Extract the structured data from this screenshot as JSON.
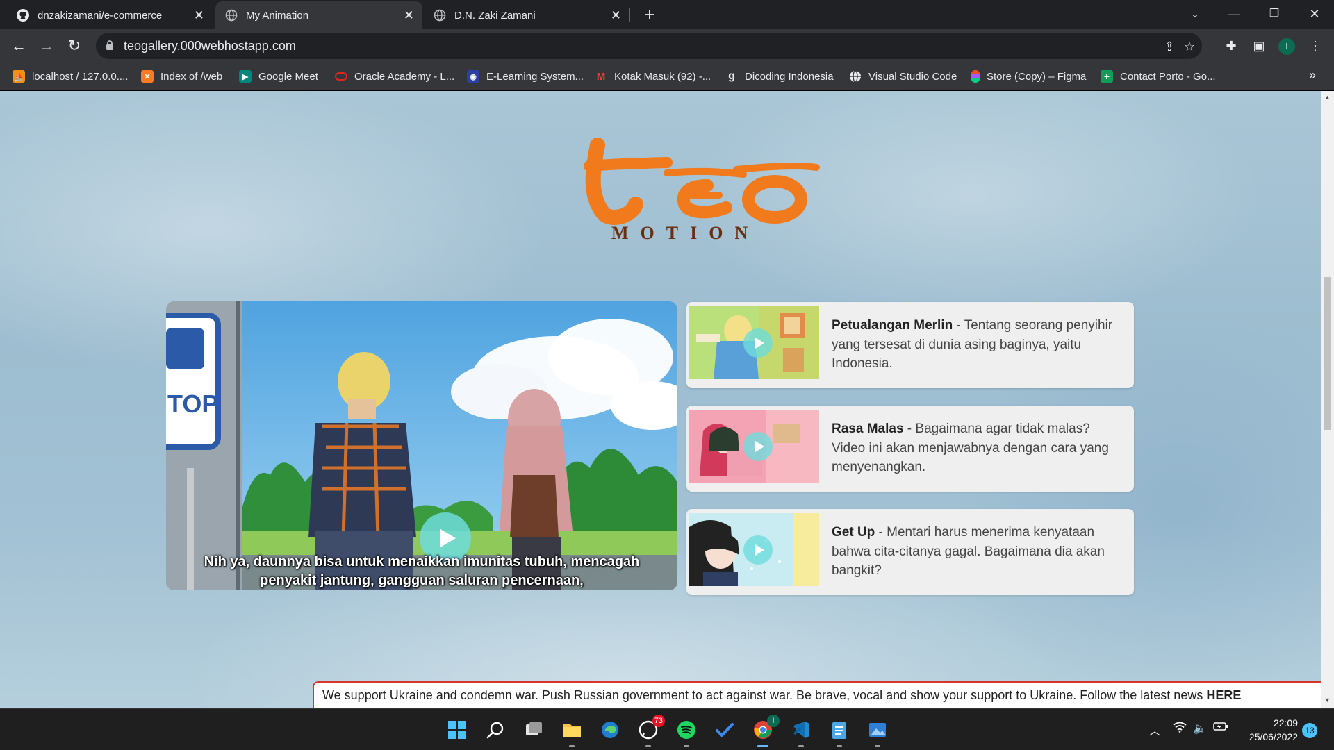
{
  "browser": {
    "tabs": [
      {
        "title": "dnzakizamani/e-commerce",
        "icon": "github-icon"
      },
      {
        "title": "My Animation",
        "icon": "globe-icon"
      },
      {
        "title": "D.N. Zaki Zamani",
        "icon": "globe-icon"
      }
    ],
    "url": "teogallery.000webhostapp.com",
    "profile_initial": "I",
    "bookmarks": [
      {
        "label": "localhost / 127.0.0....",
        "icon": "phpmyadmin-icon"
      },
      {
        "label": "Index of /web",
        "icon": "xampp-icon"
      },
      {
        "label": "Google Meet",
        "icon": "google-meet-icon"
      },
      {
        "label": "Oracle Academy - L...",
        "icon": "oracle-icon"
      },
      {
        "label": "E-Learning System...",
        "icon": "elearning-icon"
      },
      {
        "label": "Kotak Masuk (92) -...",
        "icon": "gmail-icon"
      },
      {
        "label": "Dicoding Indonesia",
        "icon": "dicoding-icon"
      },
      {
        "label": "Visual Studio Code",
        "icon": "globe-icon"
      },
      {
        "label": "Store (Copy) – Figma",
        "icon": "figma-icon"
      },
      {
        "label": "Contact Porto - Go...",
        "icon": "google-sheets-icon"
      }
    ]
  },
  "page": {
    "logo_text": "teo",
    "logo_subtitle": "MOTION",
    "main_video": {
      "subtitle_line1": "Nih ya, daunnya bisa untuk menaikkan imunitas tubuh, mencagah",
      "subtitle_line2": "penyakit jantung, gangguan saluran pencernaan,"
    },
    "videos": [
      {
        "title": "Petualangan Merlin",
        "description": " - Tentang seorang penyihir yang tersesat di dunia asing baginya, yaitu Indonesia."
      },
      {
        "title": "Rasa Malas",
        "description": " - Bagaimana agar tidak malas? Video ini akan menjawabnya dengan cara yang menyenangkan."
      },
      {
        "title": "Get Up",
        "description": " - Mentari harus menerima kenyataan bahwa cita-citanya gagal. Bagaimana dia akan bangkit?"
      }
    ],
    "banner": {
      "text": "We support Ukraine and condemn war. Push Russian government to act against war. Be brave, vocal and show your support to Ukraine. Follow the latest news ",
      "link": "HERE"
    }
  },
  "taskbar": {
    "whatsapp_badge": "73",
    "chrome_badge": "I",
    "time": "22:09",
    "date": "25/06/2022",
    "notifications": "13"
  },
  "colors": {
    "accent_orange": "#f07a1c",
    "logo_brown": "#6b2e10",
    "play_cyan": "#6edcdc",
    "banner_border": "#d9342b"
  }
}
